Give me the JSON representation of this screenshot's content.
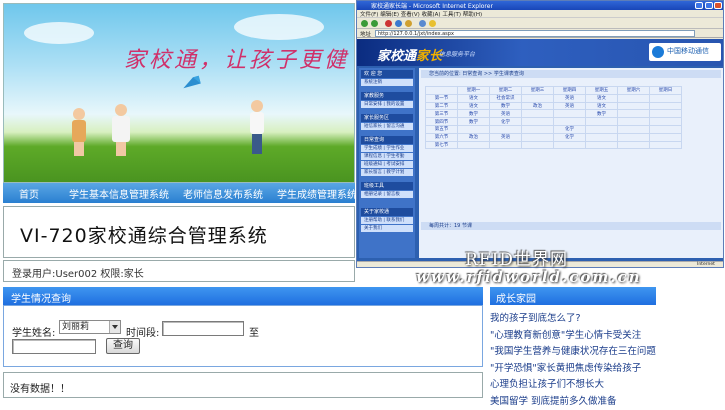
{
  "banner": {
    "slogan": "家校通，让孩子更健"
  },
  "nav": {
    "items": [
      "首页",
      "学生基本信息管理系统",
      "老师信息发布系统",
      "学生成绩管理系统"
    ]
  },
  "system_title": "VI-720家校通综合管理系统",
  "login_bar": "登录用户:User002 权限:家长",
  "query": {
    "title": "学生情况查询",
    "name_label": "学生姓名:",
    "name_selected": "刘丽莉",
    "time_label": "时间段:",
    "to_label": "至",
    "button": "查询"
  },
  "no_data": "没有数据！！",
  "garden": {
    "title": "成长家园",
    "items": [
      "我的孩子到底怎么了?",
      "\"心理教育新创意\"学生心情卡受关注",
      "\"我国学生营养与健康状况存在三在问题",
      "\"开学恐惧\"家长黄把焦虑传染给孩子",
      "心理负担让孩子们不想长大",
      "美国留学 到底提前多久做准备"
    ]
  },
  "watermark": {
    "line1": "RFID世界网",
    "line2": "www.rfidworld.com.cn"
  },
  "browser": {
    "title": "家校通家长端 - Microsoft Internet Explorer",
    "menu": "文件(F)  编辑(E)  查看(V)  收藏(A)  工具(T)  帮助(H)",
    "address_label": "地址",
    "address": "http://127.0.0.1/jxt/index.aspx",
    "logo_main": "家校通",
    "logo_accent": "家长",
    "logo_sub": "信息服务平台",
    "operator": "中国移动通信",
    "sidebar": [
      {
        "header": "欢 迎 您",
        "links": [
          "系统注销"
        ]
      },
      {
        "header": "家教服务",
        "links": [
          "日常安排 | 我的设置"
        ]
      },
      {
        "header": "家长服务区",
        "links": [
          "短信家长 | 留言沟通"
        ]
      },
      {
        "header": "日常查询",
        "links": [
          "学生成绩 | 学生作业",
          "课程信息 | 学生考勤",
          "班级通知 | 考试安排",
          "家长留言 | 教学计划"
        ]
      },
      {
        "header": "班级工具",
        "links": [
          "相册记录 | 留言板"
        ]
      },
      {
        "header": "关于家校通",
        "links": [
          "注册帮助 | 联系我们",
          "关于我们"
        ]
      }
    ],
    "crumb": "您当前的位置: 日常查询 >> 学生课表查询",
    "timetable": [
      [
        "",
        "星期一",
        "星期二",
        "星期三",
        "星期四",
        "星期五",
        "星期六",
        "星期日"
      ],
      [
        "第一节",
        "语文",
        "社会常识",
        "",
        "英语",
        "语文",
        "",
        ""
      ],
      [
        "第二节",
        "语文",
        "数学",
        "政治",
        "英语",
        "语文",
        "",
        ""
      ],
      [
        "第三节",
        "数学",
        "英语",
        "",
        "",
        "数学",
        "",
        ""
      ],
      [
        "第四节",
        "数学",
        "化学",
        "",
        "",
        "",
        "",
        ""
      ],
      [
        "第五节",
        "",
        "",
        "",
        "化学",
        "",
        "",
        ""
      ],
      [
        "第六节",
        "政治",
        "英语",
        "",
        "化学",
        "",
        "",
        ""
      ],
      [
        "第七节",
        "",
        "",
        "",
        "",
        "",
        "",
        ""
      ]
    ],
    "footer": "每周共计：19 节课",
    "status": "Internet"
  }
}
